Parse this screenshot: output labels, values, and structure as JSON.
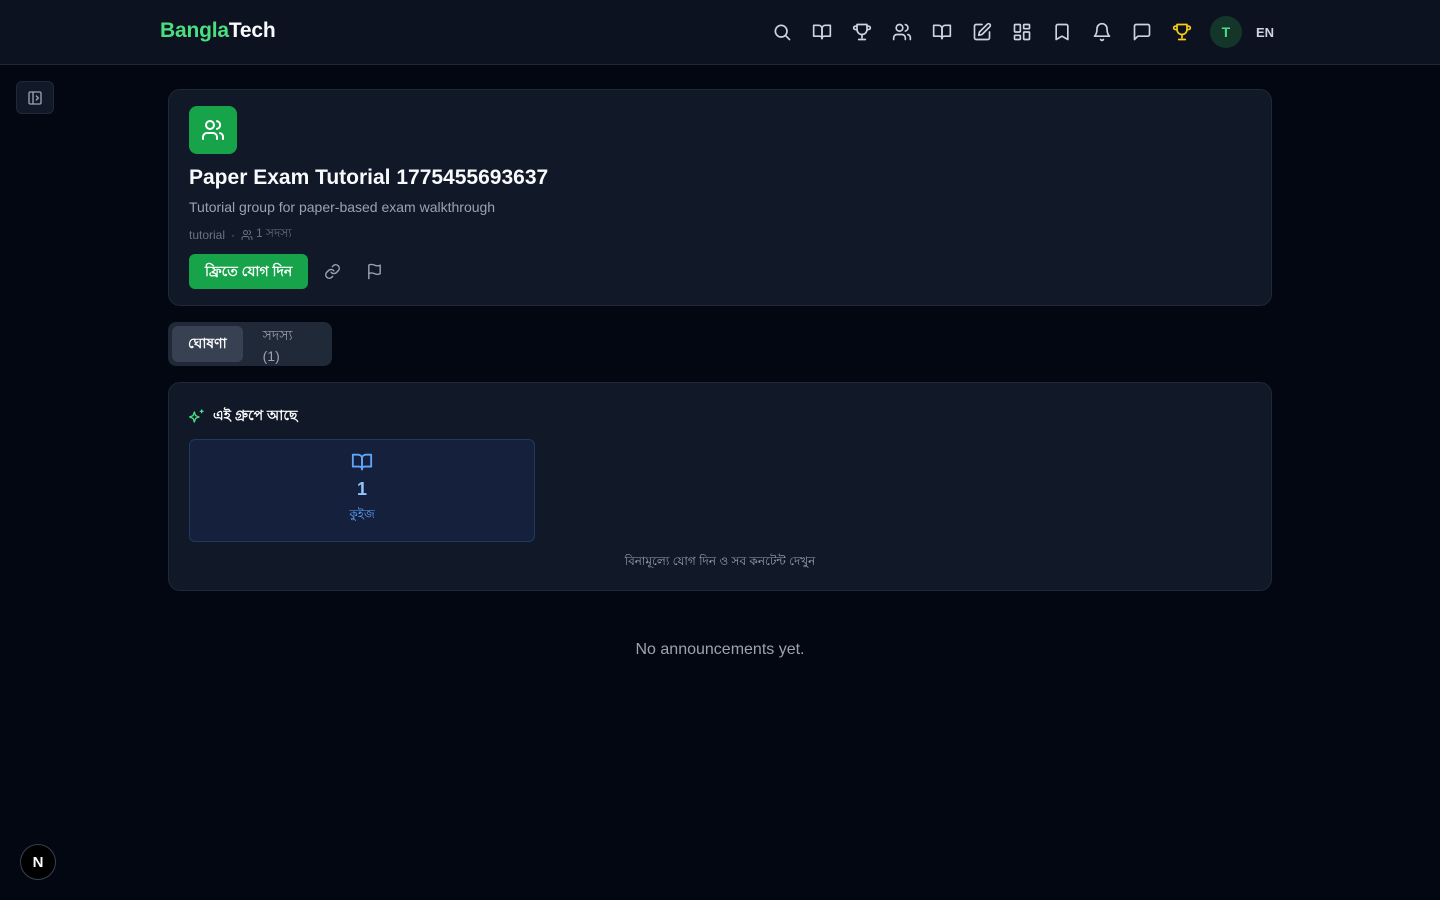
{
  "header": {
    "brand_part1": "Bangla",
    "brand_part2": "Tech",
    "nav_icons": [
      "search-icon",
      "book-open-icon",
      "trophy-icon",
      "users-icon",
      "book-open-icon",
      "edit-icon",
      "grid-icon",
      "bookmark-icon",
      "bell-icon",
      "message-icon",
      "trophy-icon"
    ],
    "avatar_initial": "T",
    "language": "EN",
    "accent_gold": "#facc15"
  },
  "group": {
    "title": "Paper Exam Tutorial 1775455693637",
    "description": "Tutorial group for paper-based exam walkthrough",
    "tag": "tutorial",
    "separator": "·",
    "member_count_label": "1 সদস্য",
    "join_label": "ফ্রিতে যোগ দিন",
    "accent_color": "#16a34a"
  },
  "tabs": [
    {
      "label": "ঘোষণা",
      "active": true
    },
    {
      "label": "সদস্য (1)",
      "active": false
    }
  ],
  "content": {
    "section_title": "এই গ্রুপে আছে",
    "stat_value": "1",
    "stat_label": "কুইজ",
    "cta": "বিনামূল্যে যোগ দিন ও সব কনটেন্ট দেখুন"
  },
  "announcements": {
    "empty_message": "No announcements yet."
  },
  "dev_badge": "N"
}
